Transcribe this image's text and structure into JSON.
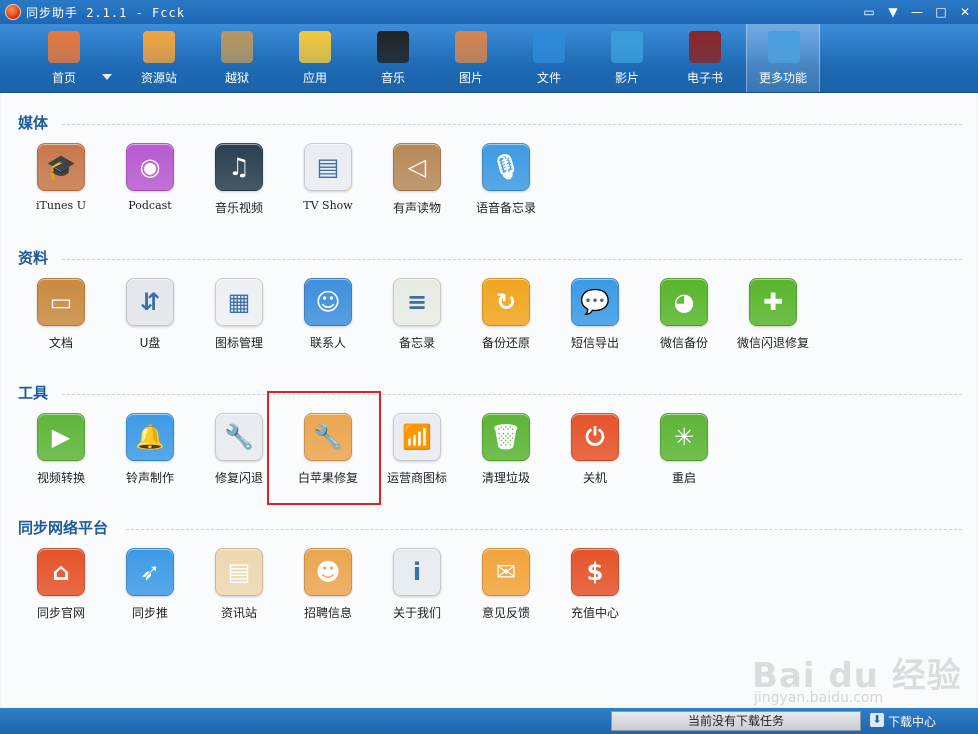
{
  "window": {
    "title": "同步助手  2.1.1  - Fcck"
  },
  "toolbar": [
    {
      "name": "home",
      "label": "首页",
      "color": "#e9783a"
    },
    {
      "name": "resources",
      "label": "资源站",
      "color": "#f2a43c"
    },
    {
      "name": "jailbreak",
      "label": "越狱",
      "color": "#b99660"
    },
    {
      "name": "apps",
      "label": "应用",
      "color": "#f3c93b"
    },
    {
      "name": "music",
      "label": "音乐",
      "color": "#222222"
    },
    {
      "name": "pictures",
      "label": "图片",
      "color": "#d7844a"
    },
    {
      "name": "files",
      "label": "文件",
      "color": "#2d8ad8"
    },
    {
      "name": "video",
      "label": "影片",
      "color": "#3a9edc"
    },
    {
      "name": "ebook",
      "label": "电子书",
      "color": "#8a2525"
    },
    {
      "name": "more",
      "label": "更多功能",
      "color": "#4aa0e0"
    }
  ],
  "sections": {
    "media": {
      "title": "媒体",
      "apps": [
        {
          "label": "iTunes U",
          "icon": "graduation-cap-icon",
          "color": "#c7784b"
        },
        {
          "label": "Podcast",
          "icon": "podcast-icon",
          "color": "#b85ad0"
        },
        {
          "label": "音乐视频",
          "icon": "music-video-icon",
          "color": "#2a3f4f"
        },
        {
          "label": "TV Show",
          "icon": "tv-icon",
          "color": "#e9edf2"
        },
        {
          "label": "有声读物",
          "icon": "audiobook-icon",
          "color": "#b7895a"
        },
        {
          "label": "语音备忘录",
          "icon": "microphone-icon",
          "color": "#3e9ae2"
        }
      ]
    },
    "data": {
      "title": "资料",
      "apps": [
        {
          "label": "文档",
          "icon": "document-icon",
          "color": "#c98a40"
        },
        {
          "label": "U盘",
          "icon": "usb-drive-icon",
          "color": "#e3e6ea"
        },
        {
          "label": "图标管理",
          "icon": "icon-grid-icon",
          "color": "#edf0f3"
        },
        {
          "label": "联系人",
          "icon": "contacts-icon",
          "color": "#3e8fdc"
        },
        {
          "label": "备忘录",
          "icon": "notes-icon",
          "color": "#e7ebe3"
        },
        {
          "label": "备份还原",
          "icon": "backup-icon",
          "color": "#f0a520"
        },
        {
          "label": "短信导出",
          "icon": "message-icon",
          "color": "#3b9ae6"
        },
        {
          "label": "微信备份",
          "icon": "wechat-icon",
          "color": "#59b52c"
        },
        {
          "label": "微信闪退修复",
          "icon": "wechat-repair-icon",
          "color": "#59b52c"
        }
      ]
    },
    "tools": {
      "title": "工具",
      "apps": [
        {
          "label": "视频转换",
          "icon": "video-convert-icon",
          "color": "#5fb53a"
        },
        {
          "label": "铃声制作",
          "icon": "bell-icon",
          "color": "#3e9ae6"
        },
        {
          "label": "修复闪退",
          "icon": "wrench-icon",
          "color": "#e7eaee"
        },
        {
          "label": "白苹果修复",
          "icon": "white-apple-repair-icon",
          "color": "#eaa64f"
        },
        {
          "label": "运营商图标",
          "icon": "carrier-icon",
          "color": "#e8ecf0"
        },
        {
          "label": "清理垃圾",
          "icon": "trash-icon",
          "color": "#5db436"
        },
        {
          "label": "关机",
          "icon": "power-icon",
          "color": "#e5532a"
        },
        {
          "label": "重启",
          "icon": "restart-icon",
          "color": "#5db436"
        }
      ]
    },
    "network": {
      "title": "同步网络平台",
      "apps": [
        {
          "label": "同步官网",
          "icon": "house-icon",
          "color": "#e5532a"
        },
        {
          "label": "同步推",
          "icon": "tongbutui-icon",
          "color": "#3e9ae6"
        },
        {
          "label": "资讯站",
          "icon": "news-icon",
          "color": "#ecd7b0"
        },
        {
          "label": "招聘信息",
          "icon": "recruit-icon",
          "color": "#eaa64f"
        },
        {
          "label": "关于我们",
          "icon": "info-icon",
          "color": "#e7ebef"
        },
        {
          "label": "意见反馈",
          "icon": "feedback-icon",
          "color": "#f2a43c"
        },
        {
          "label": "充值中心",
          "icon": "dollar-icon",
          "color": "#e5532a"
        }
      ]
    }
  },
  "statusbar": {
    "task_status": "当前没有下载任务",
    "download_center": "下载中心"
  },
  "watermark": {
    "text": "Bai du 经验",
    "sub": "jingyan.baidu.com"
  }
}
